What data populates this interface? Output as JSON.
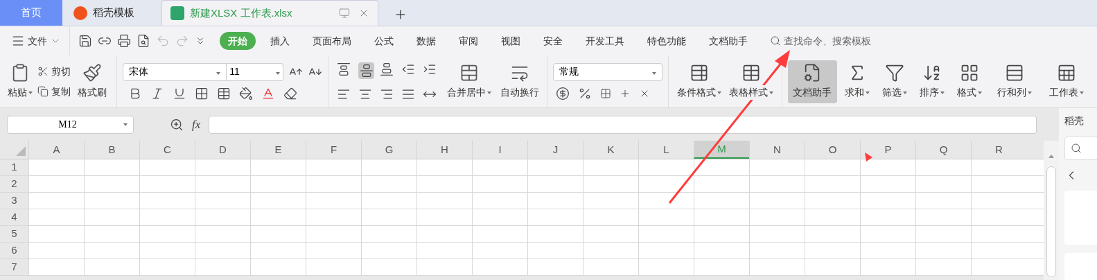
{
  "tabs": [
    {
      "label": "首页",
      "kind": "home",
      "selected": false
    },
    {
      "label": "稻壳模板",
      "kind": "template",
      "selected": false
    },
    {
      "label": "新建XLSX 工作表.xlsx",
      "kind": "sheet",
      "selected": true
    }
  ],
  "menu": {
    "file_label": "文件",
    "ribbon_tabs": [
      {
        "label": "开始",
        "selected": true
      },
      {
        "label": "插入",
        "selected": false
      },
      {
        "label": "页面布局",
        "selected": false
      },
      {
        "label": "公式",
        "selected": false
      },
      {
        "label": "数据",
        "selected": false
      },
      {
        "label": "审阅",
        "selected": false
      },
      {
        "label": "视图",
        "selected": false
      },
      {
        "label": "安全",
        "selected": false
      },
      {
        "label": "开发工具",
        "selected": false
      },
      {
        "label": "特色功能",
        "selected": false
      },
      {
        "label": "文档助手",
        "selected": false
      }
    ],
    "search_placeholder": "查找命令、搜索模板"
  },
  "ribbon": {
    "paste": "粘贴",
    "cut": "剪切",
    "copy": "复制",
    "format_painter": "格式刷",
    "font_name": "宋体",
    "font_size": "11",
    "merge": "合并居中",
    "wrap": "自动换行",
    "number_format": "常规",
    "tools": [
      {
        "label": "条件格式",
        "kind": "conditional",
        "dropdown": true,
        "selected": false
      },
      {
        "label": "表格样式",
        "kind": "tablestyle",
        "dropdown": true,
        "selected": false
      },
      {
        "label": "文档助手",
        "kind": "assistant",
        "dropdown": false,
        "selected": true
      },
      {
        "label": "求和",
        "kind": "sum",
        "dropdown": true,
        "selected": false
      },
      {
        "label": "筛选",
        "kind": "filter",
        "dropdown": true,
        "selected": false
      },
      {
        "label": "排序",
        "kind": "sort",
        "dropdown": true,
        "selected": false
      },
      {
        "label": "格式",
        "kind": "format",
        "dropdown": true,
        "selected": false
      },
      {
        "label": "行和列",
        "kind": "rowscols",
        "dropdown": true,
        "selected": false
      },
      {
        "label": "工作表",
        "kind": "worksheet",
        "dropdown": true,
        "selected": false
      }
    ]
  },
  "formula_bar": {
    "name_box": "M12",
    "fx": "fx"
  },
  "sheet": {
    "columns": [
      {
        "label": "A",
        "selected": false
      },
      {
        "label": "B",
        "selected": false
      },
      {
        "label": "C",
        "selected": false
      },
      {
        "label": "D",
        "selected": false
      },
      {
        "label": "E",
        "selected": false
      },
      {
        "label": "F",
        "selected": false
      },
      {
        "label": "G",
        "selected": false
      },
      {
        "label": "H",
        "selected": false
      },
      {
        "label": "I",
        "selected": false
      },
      {
        "label": "J",
        "selected": false
      },
      {
        "label": "K",
        "selected": false
      },
      {
        "label": "L",
        "selected": false
      },
      {
        "label": "M",
        "selected": true
      },
      {
        "label": "N",
        "selected": false
      },
      {
        "label": "O",
        "selected": false
      },
      {
        "label": "P",
        "selected": false
      },
      {
        "label": "Q",
        "selected": false
      },
      {
        "label": "R",
        "selected": false
      }
    ],
    "rows": [
      "1",
      "2",
      "3",
      "4",
      "5",
      "6",
      "7"
    ]
  },
  "side_panel": {
    "title": "稻壳"
  }
}
